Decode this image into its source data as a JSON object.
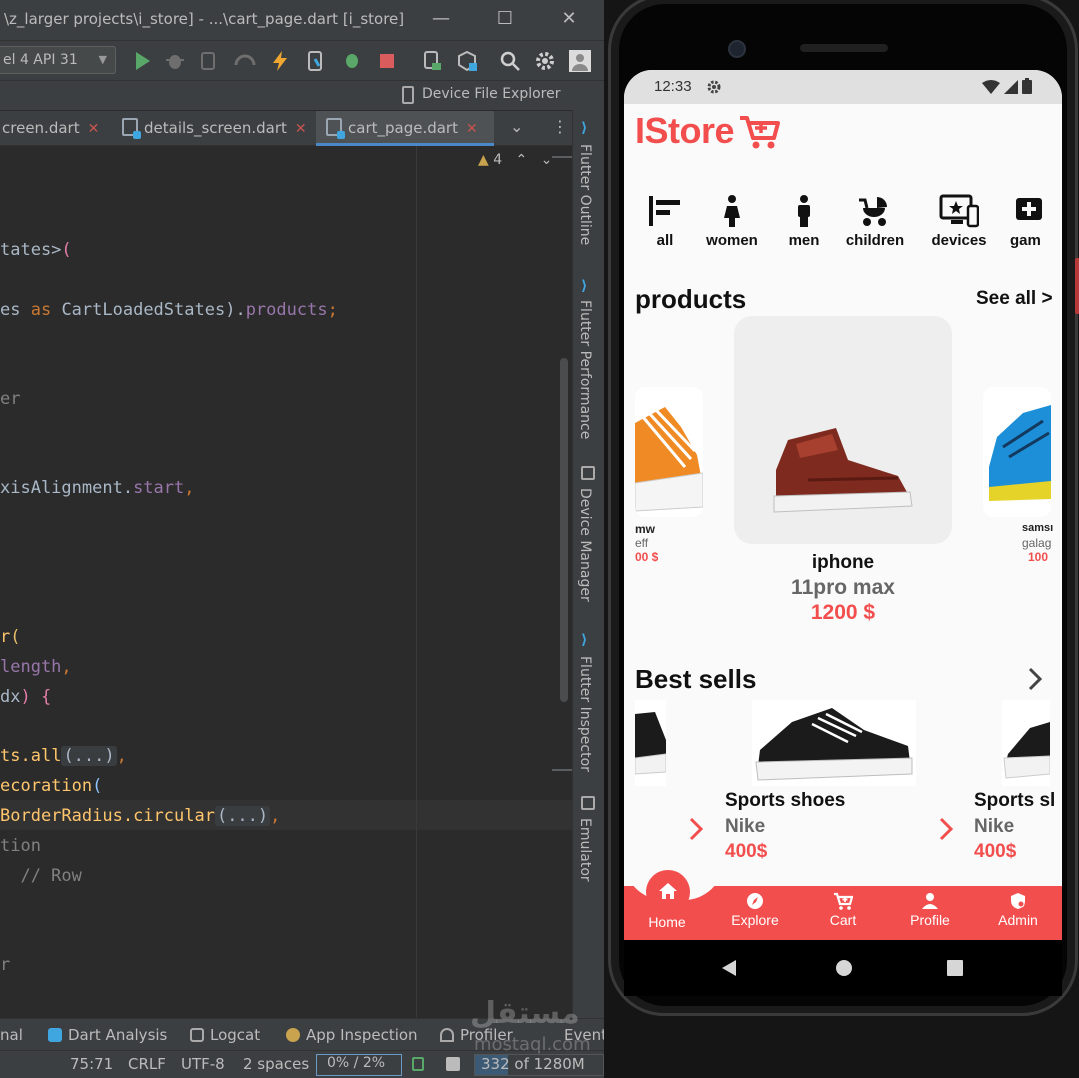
{
  "ide": {
    "title": "\\z_larger projects\\i_store] - ...\\cart_page.dart [i_store]",
    "device": "el 4 API 31",
    "device_file_explorer": "Device File Explorer",
    "tabs": [
      {
        "label": "creen.dart",
        "active": false
      },
      {
        "label": "details_screen.dart",
        "active": false
      },
      {
        "label": "cart_page.dart",
        "active": true
      }
    ],
    "warnings": "4",
    "code": {
      "l1a": "tates>",
      "l1b": "(",
      "l2a": "es ",
      "l2b": "as",
      "l2c": " CartLoadedStates",
      "l2d": ").",
      "l2e": "products",
      "l2f": ";",
      "l3": "er",
      "l4a": "xisAlignment.",
      "l4b": "start",
      "l4c": ",",
      "l5a": "r",
      "l5b": "(",
      "l6a": "length",
      "l6b": ",",
      "l7a": "dx",
      "l7b": ") {",
      "l8a": "ts.",
      "l8b": "all",
      "l8c": "(...)",
      "l8d": ",",
      "l9a": "ecoration",
      "l9b": "(",
      "l10a": "BorderRadius.",
      "l10b": "circular",
      "l10c": "(...)",
      "l10d": ",",
      "l11": "tion",
      "l12": "  // Row",
      "l13": "r"
    },
    "side_tools": [
      "Flutter Outline",
      "Flutter Performance",
      "Device Manager",
      "Flutter Inspector",
      "Emulator"
    ],
    "bottom_tabs": [
      "nal",
      "Dart Analysis",
      "Logcat",
      "App Inspection",
      "Profiler",
      "Event"
    ],
    "status": {
      "position": "75:71",
      "line_sep": "CRLF",
      "encoding": "UTF-8",
      "indent": "2 spaces",
      "progress": "0% /  2%",
      "memory": "332 of 1280M",
      "memory_fraction": 0.26
    }
  },
  "app": {
    "time": "12:33",
    "brand": "IStore",
    "categories": [
      "all",
      "women",
      "men",
      "children",
      "devices",
      "gam"
    ],
    "products_title": "products",
    "see_all": "See all >",
    "featured": {
      "name": "iphone",
      "model": "11pro max",
      "price": "1200 $"
    },
    "left_card": {
      "name": "mw",
      "model": "eff",
      "price": "00 $"
    },
    "right_card": {
      "name": "samsı",
      "model": "galag",
      "price": "100"
    },
    "best_sells_title": "Best sells",
    "best_sells": [
      {
        "name": "Sports shoes",
        "brand": "Nike",
        "price": "400$"
      },
      {
        "name": "Sports sl",
        "brand": "Nike",
        "price": "400$"
      }
    ],
    "nav": [
      "Home",
      "Explore",
      "Cart",
      "Profile",
      "Admin"
    ],
    "colors": {
      "accent": "#f34e4e",
      "ide_bg": "#2b2b2b"
    }
  },
  "watermark": {
    "arabic": "مستقل",
    "latin": "mostaql.com"
  }
}
